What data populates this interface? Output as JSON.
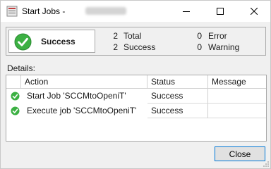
{
  "window": {
    "title": "Start Jobs -",
    "icon": "database-app-icon",
    "controls": [
      "minimize-icon",
      "maximize-icon",
      "close-icon"
    ]
  },
  "summary": {
    "status": "Success",
    "status_icon": "success-check-icon",
    "total_count": "2",
    "total_label": "Total",
    "success_count": "2",
    "success_label": "Success",
    "error_count": "0",
    "error_label": "Error",
    "warning_count": "0",
    "warning_label": "Warning"
  },
  "details": {
    "label": "Details:",
    "columns": {
      "action": "Action",
      "status": "Status",
      "message": "Message"
    },
    "rows": [
      {
        "action": "Start Job 'SCCMtoOpeniT'",
        "status": "Success",
        "message": "",
        "icon": "success-check-icon"
      },
      {
        "action": "Execute job 'SCCMtoOpeniT'",
        "status": "Success",
        "message": "",
        "icon": "success-check-icon"
      }
    ]
  },
  "buttons": {
    "close": "Close"
  },
  "colors": {
    "success_green": "#3cb043",
    "focus_border": "#0078d7"
  }
}
